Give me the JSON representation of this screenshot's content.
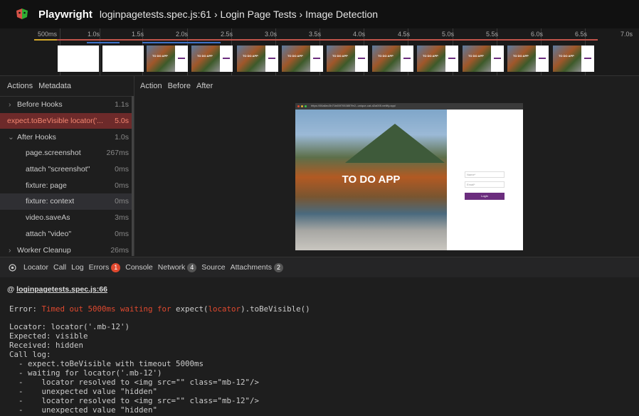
{
  "header": {
    "app_name": "Playwright",
    "test_path": "loginpagetests.spec.js:61 › Login Page Tests › Image Detection"
  },
  "timeline": {
    "ticks": [
      "500ms",
      "1.0s",
      "1.5s",
      "2.0s",
      "2.5s",
      "3.0s",
      "3.5s",
      "4.0s",
      "4.5s",
      "5.0s",
      "5.5s",
      "6.0s",
      "6.5s",
      "7.0s"
    ],
    "thumb_text": "TO DO APP"
  },
  "left_panel": {
    "tabs": [
      "Actions",
      "Metadata"
    ],
    "actions": [
      {
        "label": "Before Hooks",
        "duration": "1.1s"
      },
      {
        "label": "expect.toBeVisible locator('...",
        "duration": "5.0s"
      },
      {
        "label": "After Hooks",
        "duration": "1.0s"
      },
      {
        "label": "page.screenshot",
        "duration": "267ms"
      },
      {
        "label": "attach \"screenshot\"",
        "duration": "0ms"
      },
      {
        "label": "fixture: page",
        "duration": "0ms"
      },
      {
        "label": "fixture: context",
        "duration": "0ms"
      },
      {
        "label": "video.saveAs",
        "duration": "3ms"
      },
      {
        "label": "attach \"video\"",
        "duration": "0ms"
      },
      {
        "label": "Worker Cleanup",
        "duration": "26ms"
      }
    ]
  },
  "preview": {
    "tabs": [
      "Action",
      "Before",
      "After"
    ],
    "url": "https://06a6ec3b71b65f7053857fe2--unique-cat-d2a005.netlify.app/",
    "scene_title": "TO DO APP",
    "name_placeholder": "Name*",
    "email_placeholder": "Email*",
    "login_label": "Login"
  },
  "bottom_tabs": {
    "locator": "Locator",
    "call": "Call",
    "log": "Log",
    "errors": "Errors",
    "errors_count": "1",
    "console": "Console",
    "network": "Network",
    "network_count": "4",
    "source": "Source",
    "attachments": "Attachments",
    "attachments_count": "2"
  },
  "error_panel": {
    "location_prefix": "@ ",
    "location": "loginpagetests.spec.js:66",
    "error_prefix": "Error: ",
    "error_red1": "Timed out 5000ms waiting for ",
    "error_mid": "expect(",
    "error_red2": "locator",
    "error_tail": ").toBeVisible()",
    "lines": [
      "Locator: locator('.mb-12')",
      "Expected: visible",
      "Received: hidden",
      "Call log:",
      "  - expect.toBeVisible with timeout 5000ms",
      "  - waiting for locator('.mb-12')",
      "  -    locator resolved to <img src=\"\" class=\"mb-12\"/>",
      "  -    unexpected value \"hidden\"",
      "  -    locator resolved to <img src=\"\" class=\"mb-12\"/>",
      "  -    unexpected value \"hidden\""
    ]
  },
  "colors": {
    "error_red": "#e0492f",
    "login_purple": "#6b2d7e",
    "error_row_bg": "#6d2a2a"
  }
}
